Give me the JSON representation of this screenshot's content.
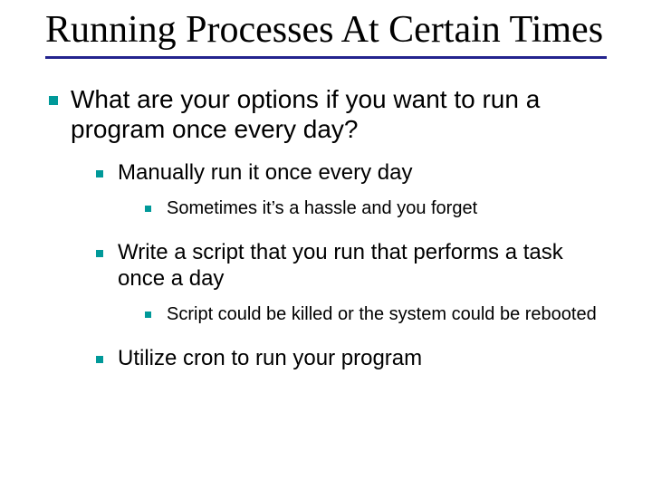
{
  "title": "Running Processes At Certain Times",
  "bullets": {
    "l1": "What are your options if you want to run a program once every day?",
    "l2a": "Manually run it once every day",
    "l3a": "Sometimes it’s a hassle and you forget",
    "l2b": "Write a script that you run that performs a task once a day",
    "l3b": "Script could be killed or the system could be rebooted",
    "l2c": "Utilize cron to run your program"
  }
}
